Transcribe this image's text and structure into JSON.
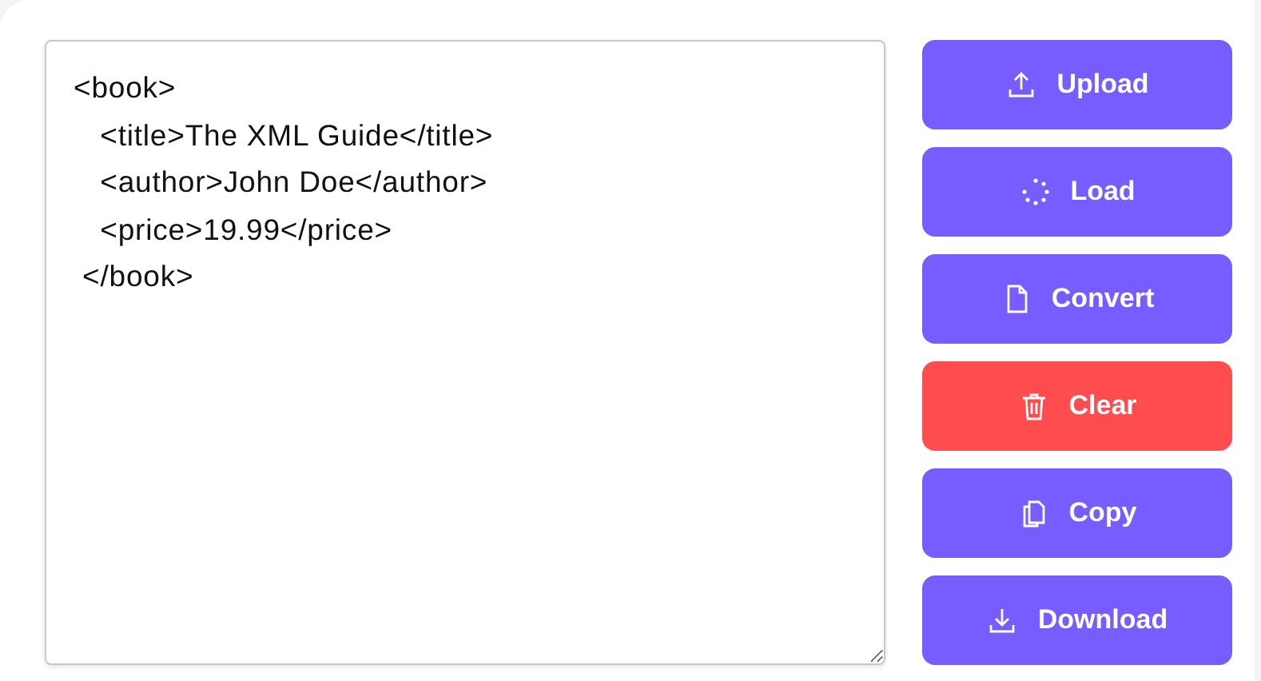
{
  "editor": {
    "lines": [
      "<book>",
      "   <title>The XML Guide</title>",
      "   <author>John Doe</author>",
      "   <price>19.99</price>",
      " </book>"
    ]
  },
  "buttons": [
    {
      "label": "Upload",
      "kind": "primary"
    },
    {
      "label": "Load",
      "kind": "primary"
    },
    {
      "label": "Convert",
      "kind": "primary"
    },
    {
      "label": "Clear",
      "kind": "danger"
    },
    {
      "label": "Copy",
      "kind": "primary"
    },
    {
      "label": "Download",
      "kind": "primary"
    }
  ]
}
